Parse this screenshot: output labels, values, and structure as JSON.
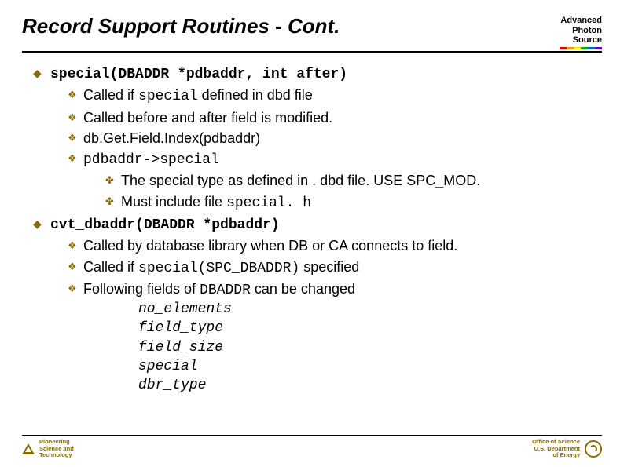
{
  "title": "Record Support Routines - Cont.",
  "logo_aps": {
    "l1": "Advanced",
    "l2": "Photon",
    "l3": "Source"
  },
  "s1": {
    "sig": "special(DBADDR *pdbaddr, int after)",
    "b1a": "Called if ",
    "b1b": "special",
    "b1c": " defined in dbd file",
    "b2": "Called before and after field is modified.",
    "b3": "db.Get.Field.Index(pdbaddr)",
    "b4": "pdbaddr->special",
    "c1": " The special type as defined in . dbd file. USE SPC_MOD.",
    "c2a": "Must include file ",
    "c2b": "special. h"
  },
  "s2": {
    "sig": "cvt_dbaddr(DBADDR *pdbaddr)",
    "b1": "Called by database library when DB or CA connects to field.",
    "b2a": "Called if ",
    "b2b": "special(SPC_DBADDR)",
    "b2c": " specified",
    "b3a": "Following fields of ",
    "b3b": "DBADDR",
    "b3c": " can be changed",
    "f1": "no_elements",
    "f2": "field_type",
    "f3": "field_size",
    "f4": "special",
    "f5": "dbr_type"
  },
  "footer": {
    "left1": "Pioneering",
    "left2": "Science and",
    "left3": "Technology",
    "right1": "Office of Science",
    "right2": "U.S. Department",
    "right3": "of Energy"
  }
}
